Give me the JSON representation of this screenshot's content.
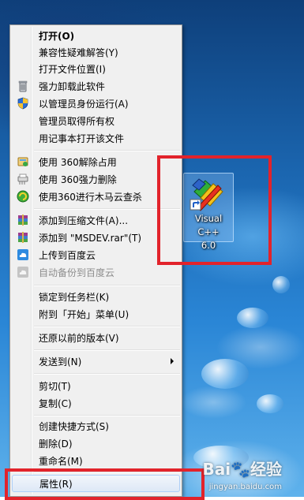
{
  "menu": {
    "items": [
      {
        "label": "打开(O)",
        "icon": "none",
        "bold": true
      },
      {
        "label": "兼容性疑难解答(Y)",
        "icon": "none"
      },
      {
        "label": "打开文件位置(I)",
        "icon": "none"
      },
      {
        "label": "强力卸载此软件",
        "icon": "trash-icon"
      },
      {
        "label": "以管理员身份运行(A)",
        "icon": "uac-shield-icon"
      },
      {
        "label": "管理员取得所有权",
        "icon": "none"
      },
      {
        "label": "用记事本打开该文件",
        "icon": "none"
      },
      {
        "label": "使用 360解除占用",
        "icon": "360-unlock-icon"
      },
      {
        "label": "使用 360强力删除",
        "icon": "360-shred-icon"
      },
      {
        "label": "使用360进行木马云查杀",
        "icon": "360-scan-icon"
      },
      {
        "label": "添加到压缩文件(A)...",
        "icon": "winrar-icon"
      },
      {
        "label": "添加到 \"MSDEV.rar\"(T)",
        "icon": "winrar-icon"
      },
      {
        "label": "上传到百度云",
        "icon": "baidu-cloud-icon"
      },
      {
        "label": "自动备份到百度云",
        "icon": "baidu-cloud-icon",
        "disabled": true
      },
      {
        "label": "锁定到任务栏(K)",
        "icon": "none"
      },
      {
        "label": "附到「开始」菜单(U)",
        "icon": "none"
      },
      {
        "label": "还原以前的版本(V)",
        "icon": "none"
      },
      {
        "label": "发送到(N)",
        "icon": "none",
        "submenu": true
      },
      {
        "label": "剪切(T)",
        "icon": "none"
      },
      {
        "label": "复制(C)",
        "icon": "none"
      },
      {
        "label": "创建快捷方式(S)",
        "icon": "none"
      },
      {
        "label": "删除(D)",
        "icon": "none"
      },
      {
        "label": "重命名(M)",
        "icon": "none"
      },
      {
        "label": "属性(R)",
        "icon": "none",
        "highlighted": true
      }
    ]
  },
  "desktop_icon": {
    "line1": "Visual C++",
    "line2": "6.0",
    "icon": "visual-cpp-shortcut-icon"
  },
  "watermark": {
    "brand": "Bai",
    "brand2": "经验",
    "url": "jingyan.baidu.com"
  },
  "colors": {
    "highlight_box": "#e2232b",
    "menu_bg": "#f0f0f0",
    "selection": "#dde8f6"
  }
}
